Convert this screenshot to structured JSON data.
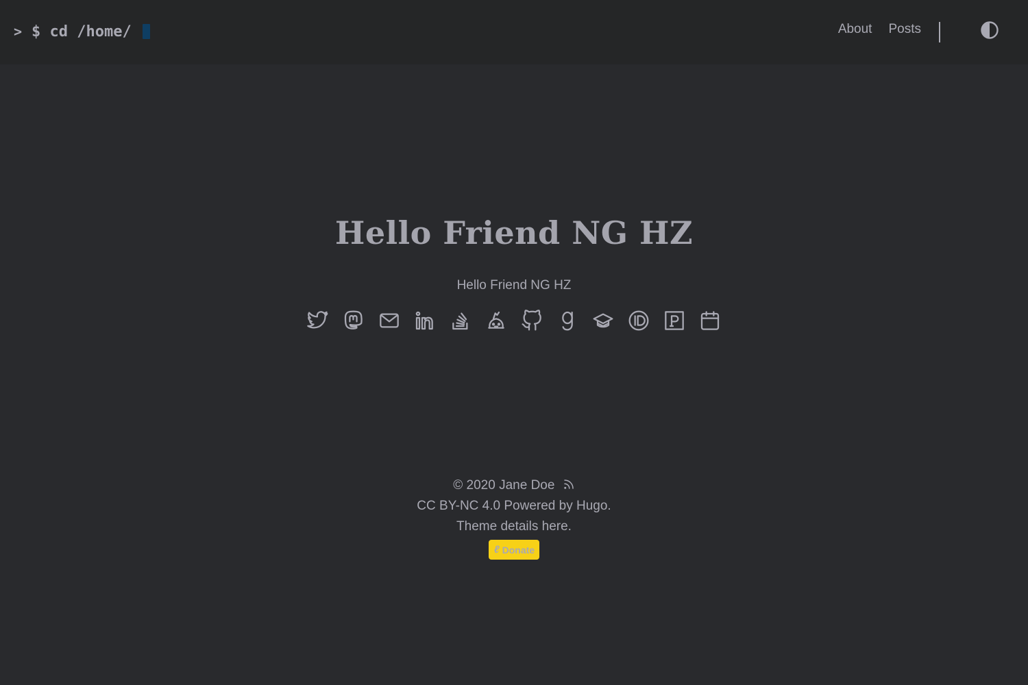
{
  "header": {
    "logo": {
      "prompt": ">",
      "text": "$ cd /home/"
    },
    "nav": [
      {
        "label": "About"
      },
      {
        "label": "Posts"
      }
    ],
    "theme_toggle_icon": "contrast-toggle-icon"
  },
  "main": {
    "title": "Hello Friend NG HZ",
    "subtitle": "Hello Friend NG HZ",
    "social_icons": [
      "twitter-icon",
      "mastodon-icon",
      "email-icon",
      "linkedin-icon",
      "stackoverflow-icon",
      "kaggle-icon",
      "github-icon",
      "goodreads-icon",
      "scholar-icon",
      "orcid-icon",
      "patreon-icon",
      "calendar-icon"
    ]
  },
  "footer": {
    "copyright": "© 2020 Jane Doe",
    "license_line": "CC BY-NC 4.0 Powered by Hugo.",
    "theme_line": "Theme details here.",
    "donate_label": "Donate",
    "donate_icon_glyph": "lp"
  },
  "colors": {
    "background": "#292a2d",
    "header_background": "#252627",
    "text": "#a9a9b3",
    "cursor": "#0e3e63",
    "donate_button": "#f7d117"
  }
}
